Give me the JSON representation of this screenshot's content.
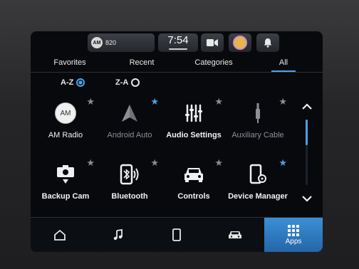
{
  "status": {
    "radio_badge": "AM",
    "radio_freq": "820",
    "clock": "7:54"
  },
  "tabs": [
    {
      "label": "Favorites"
    },
    {
      "label": "Recent"
    },
    {
      "label": "Categories"
    },
    {
      "label": "All",
      "active": true
    }
  ],
  "sort": {
    "az_label": "A-Z",
    "za_label": "Z-A",
    "selected": "A-Z"
  },
  "apps": [
    {
      "label": "AM Radio",
      "icon": "am-radio-icon",
      "icon_text": "AM",
      "favorite": false,
      "dimmed": false
    },
    {
      "label": "Android Auto",
      "icon": "android-auto-icon",
      "favorite": true,
      "dimmed": true
    },
    {
      "label": "Audio Settings",
      "icon": "equalizer-icon",
      "favorite": false,
      "dimmed": false
    },
    {
      "label": "Auxiliary Cable",
      "icon": "aux-cable-icon",
      "favorite": false,
      "dimmed": true
    },
    {
      "label": "Backup Cam",
      "icon": "backup-camera-icon",
      "favorite": false,
      "dimmed": false
    },
    {
      "label": "Bluetooth",
      "icon": "bluetooth-phone-icon",
      "favorite": true,
      "dimmed": false
    },
    {
      "label": "Controls",
      "icon": "car-controls-icon",
      "favorite": false,
      "dimmed": false
    },
    {
      "label": "Device Manager",
      "icon": "device-manager-icon",
      "favorite": true,
      "dimmed": false
    }
  ],
  "dock": {
    "apps_label": "Apps",
    "items": [
      "home-icon",
      "music-note-icon",
      "phone-icon",
      "car-icon",
      "apps-grid-icon"
    ]
  },
  "colors": {
    "accent": "#4aa3e6",
    "star_off": "#8a8d93",
    "star_on": "#4aa3e6"
  }
}
